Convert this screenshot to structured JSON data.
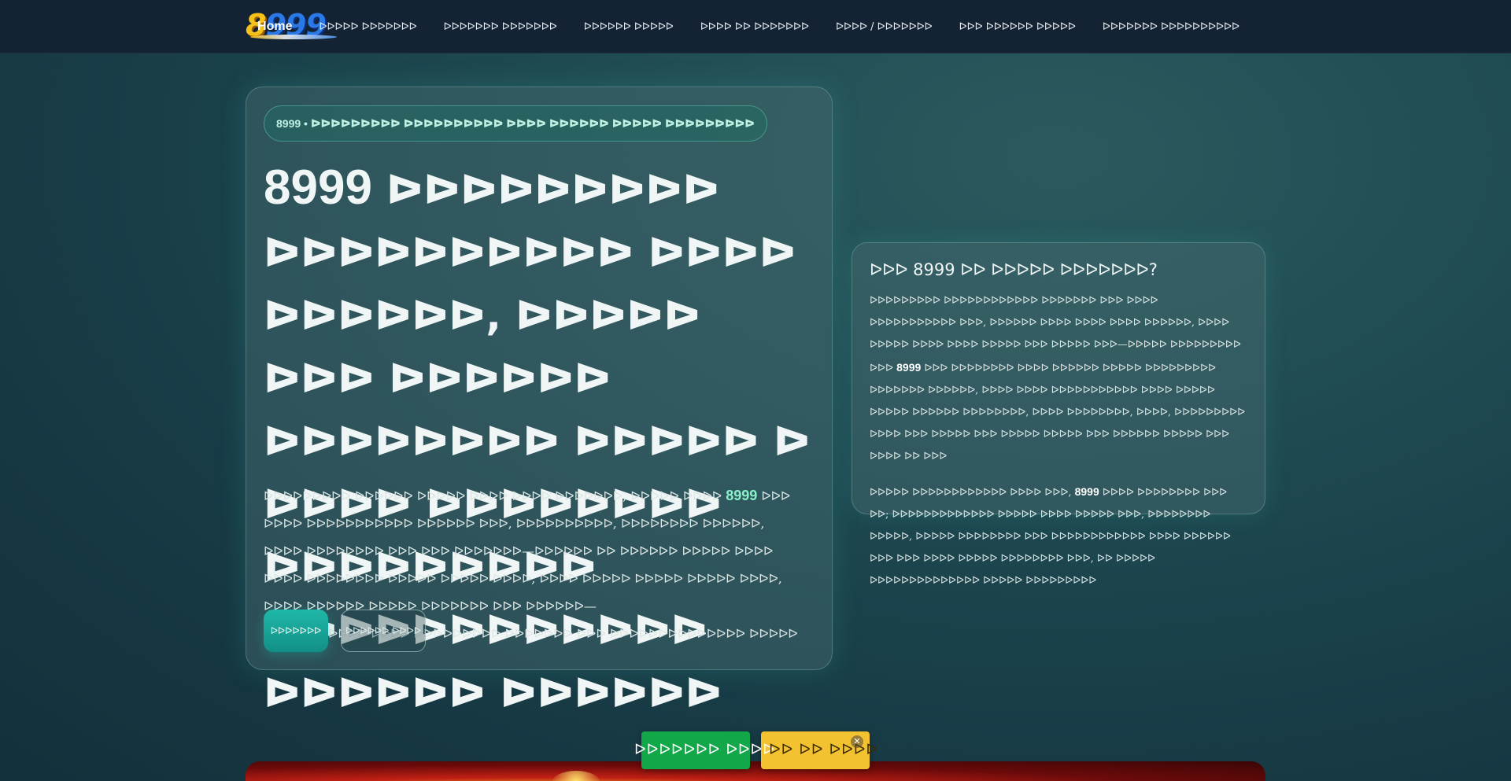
{
  "header": {
    "logo_text": "8999",
    "nav": [
      {
        "label": "Home",
        "active": true
      },
      {
        "label": "ᐅᐅᐅᐅᐅ ᐅᐅᐅᐅᐅᐅᐅ"
      },
      {
        "label": "ᐅᐅᐅᐅᐅᐅᐅ ᐅᐅᐅᐅᐅᐅᐅ"
      },
      {
        "label": "ᐅᐅᐅᐅᐅᐅ ᐅᐅᐅᐅᐅ"
      },
      {
        "label": "ᐅᐅᐅᐅ ᐅᐅ ᐅᐅᐅᐅᐅᐅᐅ"
      },
      {
        "label": "ᐅᐅᐅᐅ / ᐅᐅᐅᐅᐅᐅᐅ"
      },
      {
        "label": "ᐅᐅᐅ ᐅᐅᐅᐅᐅᐅ ᐅᐅᐅᐅᐅ"
      },
      {
        "label": "ᐅᐅᐅᐅᐅᐅᐅ ᐅᐅᐅᐅᐅᐅᐅᐅᐅᐅ"
      }
    ]
  },
  "hero": {
    "pill": "8999 • ᐅᐅᐅᐅᐅᐅᐅᐅᐅ ᐅᐅᐅᐅᐅᐅᐅᐅᐅᐅ ᐅᐅᐅᐅ ᐅᐅᐅᐅᐅᐅ ᐅᐅᐅᐅᐅ ᐅᐅᐅᐅᐅᐅᐅᐅᐅ",
    "title_brand": "8999",
    "title_rest": "ᐅᐅᐅᐅᐅᐅᐅᐅᐅ ᐅᐅᐅᐅᐅᐅᐅᐅᐅᐅ ᐅᐅᐅᐅ ᐅᐅᐅᐅᐅᐅ, ᐅᐅᐅᐅᐅ ᐅᐅᐅ ᐅᐅᐅᐅᐅᐅ ᐅᐅᐅᐅᐅᐅᐅᐅ ᐅᐅᐅᐅᐅ ᐅ ᐅᐅᐅᐅ ᐅᐅᐅᐅᐅᐅᐅᐅ ᐅᐅᐅᐅᐅᐅᐅᐅᐅ ᐅᐅᐅᐅᐅᐅᐅᐅᐅᐅᐅᐅ ᐅᐅᐅᐅᐅᐅ ᐅᐅᐅᐅᐅᐅ",
    "desc_1": "ᐅᐅᐅᐅᐅᐅᐅᐅᐅ ᐅᐅᐅᐅᐅᐅ ᐅᐅᐅᐅᐅ ᐅᐅᐅᐅ ᐅᐅᐅᐅ ᐅᐅᐅᐅᐅᐅᐅ, ᐅᐅᐅᐅᐅ ᐅᐅᐅᐅ ",
    "desc_brand_1": "8999",
    "desc_2": " ᐅᐅᐅ ᐅᐅᐅᐅ ᐅᐅᐅᐅᐅᐅᐅᐅᐅᐅᐅ ᐅᐅᐅᐅᐅᐅ ᐅᐅᐅ, ᐅᐅᐅᐅᐅᐅᐅᐅᐅᐅ, ᐅᐅᐅᐅᐅᐅᐅᐅ ᐅᐅᐅᐅᐅᐅ, ᐅᐅᐅᐅ ᐅᐅᐅᐅᐅᐅᐅᐅ ᐅᐅᐅ ᐅᐅᐅ ᐅᐅᐅᐅᐅᐅᐅ—ᐅᐅᐅᐅᐅᐅ ᐅᐅ ᐅᐅᐅᐅᐅᐅ ᐅᐅᐅᐅᐅ ᐅᐅᐅᐅ ᐅᐅᐅᐅ ᐅᐅᐅᐅᐅᐅᐅᐅ ᐅᐅᐅᐅᐅ ᐅᐅᐅᐅᐅ ᐅᐅᐅᐅ, ᐅᐅᐅᐅ ᐅᐅᐅᐅᐅ ᐅᐅᐅᐅᐅ ᐅᐅᐅᐅᐅ ᐅᐅᐅᐅ, ᐅᐅᐅᐅ ᐅᐅᐅᐅᐅᐅ ᐅᐅᐅᐅᐅ ᐅᐅᐅᐅᐅᐅᐅ ᐅᐅᐅ ᐅᐅᐅᐅᐅᐅ—",
    "desc_brand_2": "8999",
    "desc_3": " ᐅᐅᐅᐅᐅᐅᐅ ᐅᐅᐅᐅ ᐅᐅᐅᐅᐅᐅᐅᐅᐅ ᐅᐅᐅᐅᐅᐅᐅ ᐅᐅᐅ ᐅᐅᐅᐅᐅᐅᐅᐅᐅᐅᐅᐅᐅᐅ ᐅᐅᐅᐅᐅ",
    "btn_primary": "ᐅᐅᐅᐅᐅᐅᐅ",
    "btn_secondary": "ᐅᐅᐅᐅᐅᐅ ᐅᐅᐅᐅ"
  },
  "side": {
    "title": "ᐅᐅᐅ 8999 ᐅᐅ ᐅᐅᐅᐅᐅ ᐅᐅᐅᐅᐅᐅᐅ?",
    "p1_a": "ᐅᐅᐅᐅᐅᐅᐅᐅᐅ ᐅᐅᐅᐅᐅᐅᐅᐅᐅᐅᐅᐅ ᐅᐅᐅᐅᐅᐅᐅ ᐅᐅᐅ ᐅᐅᐅᐅ ᐅᐅᐅᐅᐅᐅᐅᐅᐅᐅᐅ ᐅᐅᐅ, ᐅᐅᐅᐅᐅᐅ ᐅᐅᐅᐅ ᐅᐅᐅᐅ ᐅᐅᐅᐅ ᐅᐅᐅᐅᐅᐅ, ᐅᐅᐅᐅ ᐅᐅᐅᐅᐅ ᐅᐅᐅᐅ ᐅᐅᐅᐅ ᐅᐅᐅᐅᐅ ᐅᐅᐅ ᐅᐅᐅᐅᐅ ᐅᐅᐅ—ᐅᐅᐅᐅᐅ ᐅᐅᐅᐅᐅᐅᐅᐅᐅ ᐅᐅᐅ ",
    "p1_brand": "8999",
    "p1_b": " ᐅᐅᐅ ᐅᐅᐅᐅᐅᐅᐅᐅ ᐅᐅᐅᐅ ᐅᐅᐅᐅᐅᐅ ᐅᐅᐅᐅᐅ ᐅᐅᐅᐅᐅᐅᐅᐅᐅ ᐅᐅᐅᐅᐅᐅᐅ ᐅᐅᐅᐅᐅᐅ, ᐅᐅᐅᐅ ᐅᐅᐅᐅ ᐅᐅᐅᐅᐅᐅᐅᐅᐅᐅᐅ ᐅᐅᐅᐅ ᐅᐅᐅᐅᐅ ᐅᐅᐅᐅᐅ ᐅᐅᐅᐅᐅᐅ ᐅᐅᐅᐅᐅᐅᐅᐅ, ᐅᐅᐅᐅ ᐅᐅᐅᐅᐅᐅᐅᐅ, ᐅᐅᐅᐅ, ᐅᐅᐅᐅᐅᐅᐅᐅᐅ ᐅᐅᐅᐅ ᐅᐅᐅ ᐅᐅᐅᐅᐅ ᐅᐅᐅ ᐅᐅᐅᐅᐅ ᐅᐅᐅᐅᐅ ᐅᐅᐅ ᐅᐅᐅᐅᐅᐅ ᐅᐅᐅᐅᐅ ᐅᐅᐅ ᐅᐅᐅᐅ ᐅᐅ ᐅᐅᐅ",
    "p2_a": "ᐅᐅᐅᐅᐅ ᐅᐅᐅᐅᐅᐅᐅᐅᐅᐅᐅᐅ ᐅᐅᐅᐅ ᐅᐅᐅ, ",
    "p2_brand": "8999",
    "p2_b": " ᐅᐅᐅᐅ ᐅᐅᐅᐅᐅᐅᐅᐅ ᐅᐅᐅ ᐅᐅ; ᐅᐅᐅᐅᐅᐅᐅᐅᐅᐅᐅᐅᐅ ᐅᐅᐅᐅᐅ ᐅᐅᐅᐅ ᐅᐅᐅᐅᐅ ᐅᐅᐅ, ᐅᐅᐅᐅᐅᐅᐅᐅ ᐅᐅᐅᐅᐅ, ᐅᐅᐅᐅᐅ ᐅᐅᐅᐅᐅᐅᐅᐅ ᐅᐅᐅ ᐅᐅᐅᐅᐅᐅᐅᐅᐅᐅᐅᐅ ᐅᐅᐅᐅ ᐅᐅᐅᐅᐅᐅ ᐅᐅᐅ ᐅᐅᐅ ᐅᐅᐅᐅ ᐅᐅᐅᐅᐅ ᐅᐅᐅᐅᐅᐅᐅᐅ ᐅᐅᐅ, ᐅᐅ ᐅᐅᐅᐅᐅ ᐅᐅᐅᐅᐅᐅᐅᐅᐅᐅᐅᐅᐅᐅ ᐅᐅᐅᐅᐅ ᐅᐅᐅᐅᐅᐅᐅᐅᐅ"
  },
  "floating": {
    "green_label": "ᐅᐅᐅᐅᐅᐅᐅ ᐅᐅᐅᐅ",
    "yellow_label": "ᐅᐅ ᐅᐅ ᐅᐅᐅᐅ",
    "close_glyph": "✕"
  },
  "colors": {
    "accent_teal": "#1fb8a8",
    "highlight_green": "#86f0c9",
    "nav_bg": "#142334",
    "float_green": "#12a84a",
    "float_yellow": "#f2c230"
  }
}
